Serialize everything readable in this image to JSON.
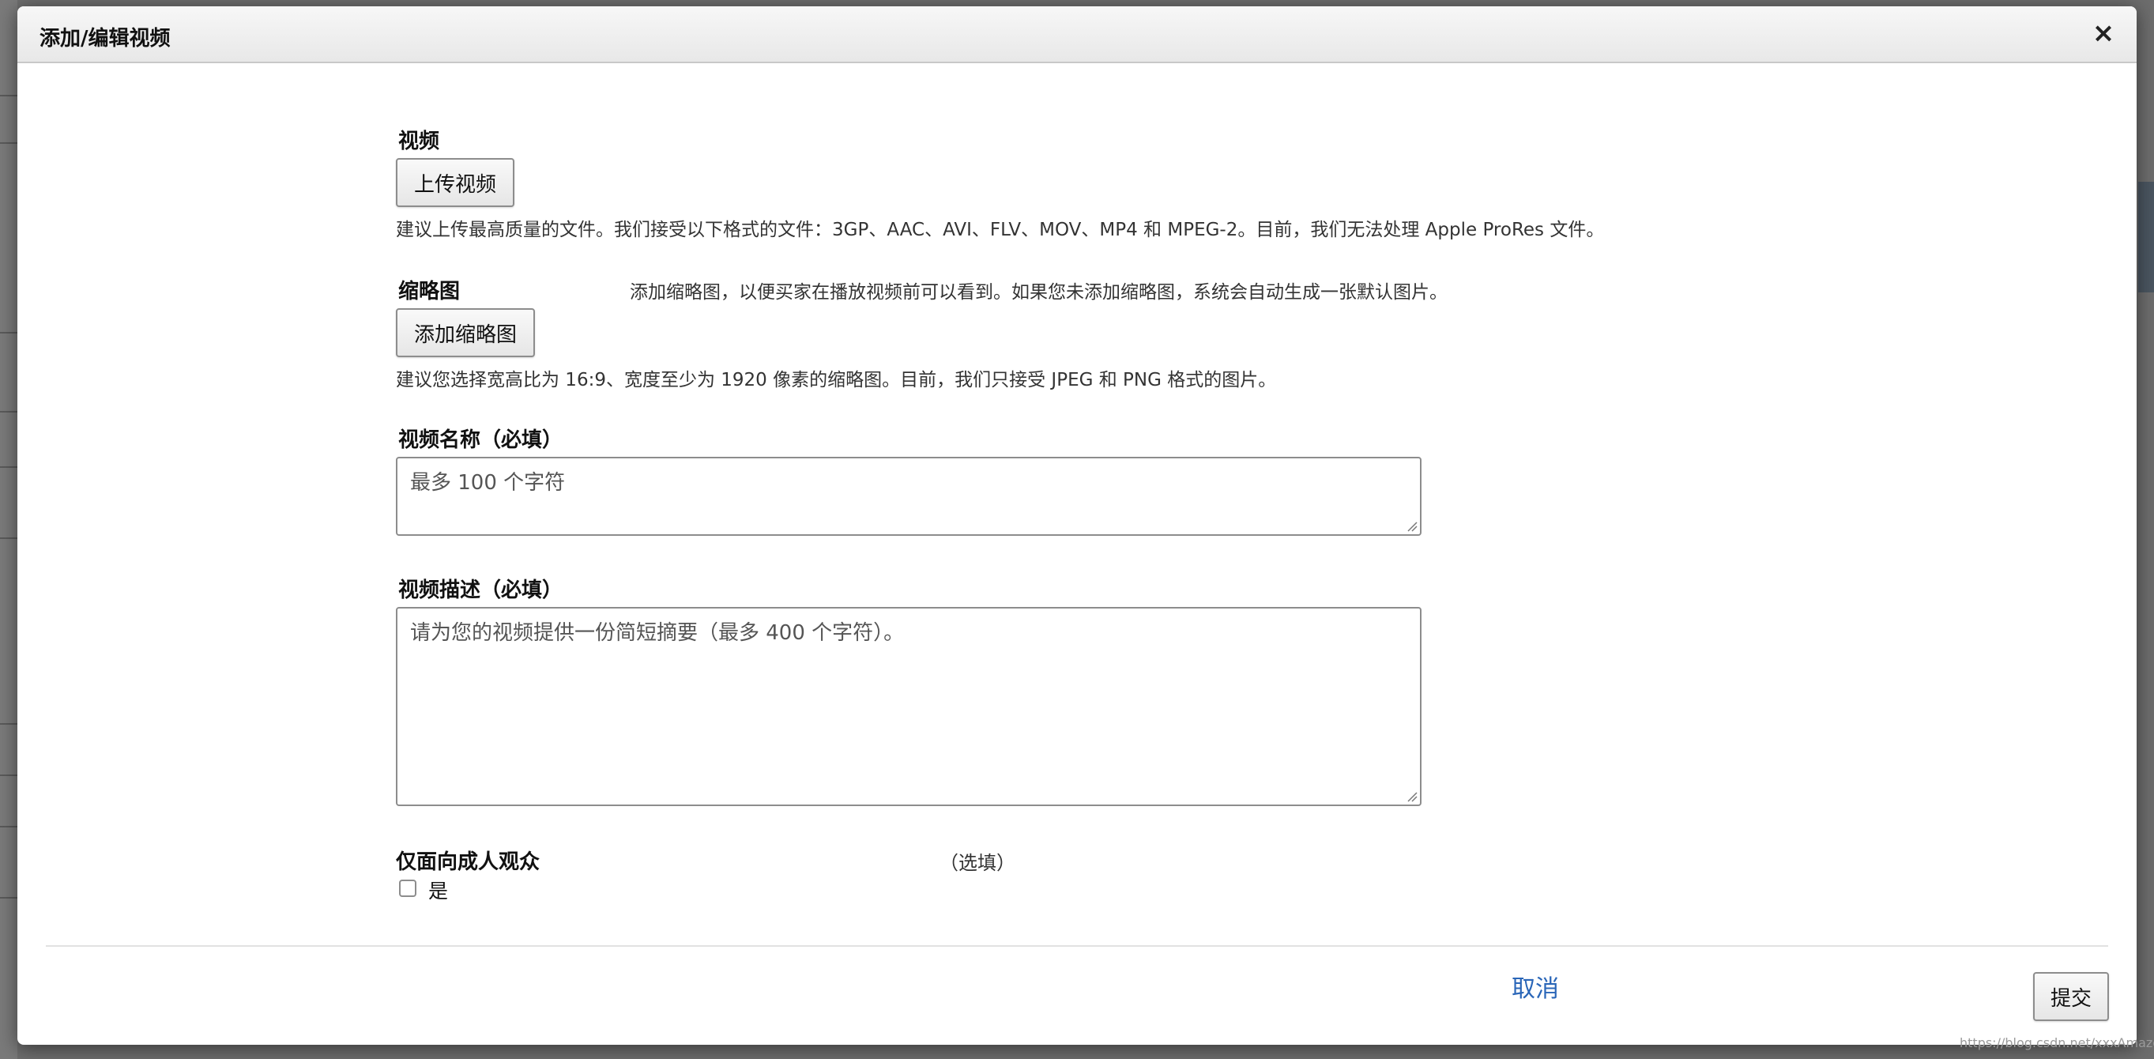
{
  "modal": {
    "title": "添加/编辑视频",
    "close_label": "×"
  },
  "video": {
    "label": "视频",
    "upload_button": "上传视频",
    "hint": "建议上传最高质量的文件。我们接受以下格式的文件：3GP、AAC、AVI、FLV、MOV、MP4 和 MPEG-2。目前，我们无法处理 Apple ProRes 文件。"
  },
  "thumbnail": {
    "label": "缩略图",
    "side_hint": "添加缩略图，以便买家在播放视频前可以看到。如果您未添加缩略图，系统会自动生成一张默认图片。",
    "add_button": "添加缩略图",
    "hint": "建议您选择宽高比为 16:9、宽度至少为 1920 像素的缩略图。目前，我们只接受 JPEG 和 PNG 格式的图片。"
  },
  "video_name": {
    "label": "视频名称（必填）",
    "placeholder": "最多 100 个字符",
    "value": ""
  },
  "video_description": {
    "label": "视频描述（必填）",
    "placeholder": "请为您的视频提供一份简短摘要（最多 400 个字符）。",
    "value": ""
  },
  "adult_only": {
    "label": "仅面向成人观众",
    "optional_label": "（选填）",
    "checkbox_label": "是",
    "checked": false
  },
  "footer": {
    "cancel_label": "取消",
    "submit_label": "提交"
  },
  "watermark": "https://blog.csdn.net/xxxAmazon"
}
